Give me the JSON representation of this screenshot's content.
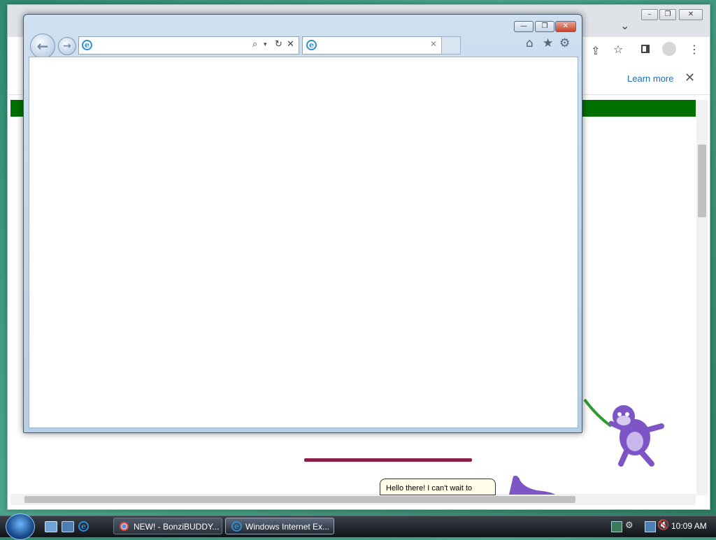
{
  "chrome": {
    "learn_more": "Learn more",
    "close_glyph": "✕",
    "minimize_glyph": "–",
    "restore_glyph": "❐",
    "window_close_glyph": "✕",
    "chevron_glyph": "⌄"
  },
  "ie": {
    "title_minimize": "—",
    "title_restore": "❐",
    "title_close": "✕",
    "address_value": "",
    "tab_label": "",
    "icons": [
      "home-icon",
      "favorites-star-icon",
      "tools-gear-icon"
    ]
  },
  "page": {
    "bubble_text": "Hello there! I can't wait to"
  },
  "taskbar": {
    "items": [
      {
        "label": "NEW! - BonziBUDDY...",
        "icon": "chrome-icon"
      },
      {
        "label": "Windows Internet Ex...",
        "icon": "internet-explorer-icon"
      }
    ],
    "clock": "10:09 AM"
  },
  "colors": {
    "desktop": "#3b957a",
    "green_banner": "#007000",
    "link": "#1a6fc2",
    "ie_frame": "#c4d7ea"
  }
}
